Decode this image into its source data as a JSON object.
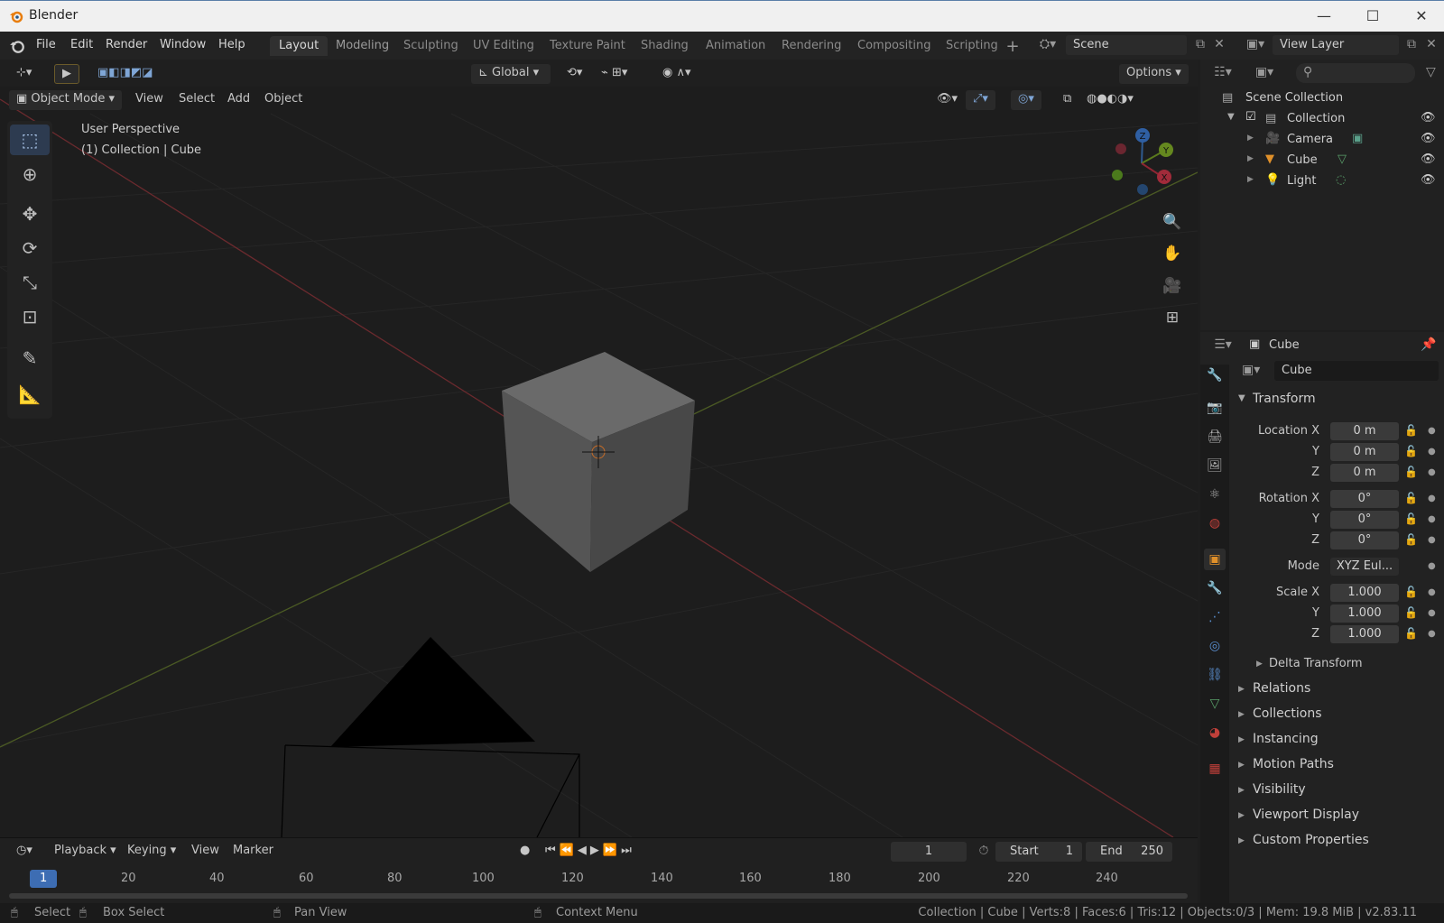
{
  "window": {
    "title": "Blender"
  },
  "menu": {
    "items": [
      "File",
      "Edit",
      "Render",
      "Window",
      "Help"
    ]
  },
  "workspaces": [
    {
      "label": "Layout",
      "active": true
    },
    {
      "label": "Modeling"
    },
    {
      "label": "Sculpting"
    },
    {
      "label": "UV Editing"
    },
    {
      "label": "Texture Paint"
    },
    {
      "label": "Shading"
    },
    {
      "label": "Animation"
    },
    {
      "label": "Rendering"
    },
    {
      "label": "Compositing"
    },
    {
      "label": "Scripting"
    }
  ],
  "scene": {
    "name": "Scene",
    "view_layer": "View Layer"
  },
  "viewport": {
    "transform_orientation": "Global",
    "options_label": "Options",
    "mode": "Object Mode",
    "header_menus": [
      "View",
      "Select",
      "Add",
      "Object"
    ],
    "perspective_text": "User Perspective",
    "context_text": "(1) Collection | Cube",
    "gizmo": {
      "x": "X",
      "y": "Y",
      "z": "Z"
    }
  },
  "outliner": {
    "root": "Scene Collection",
    "collection": "Collection",
    "objects": [
      "Camera",
      "Cube",
      "Light"
    ]
  },
  "properties": {
    "object_name_header": "Cube",
    "object_name_field": "Cube",
    "transform_title": "Transform",
    "location_label": "Location X",
    "rotation_label": "Rotation X",
    "mode_label": "Mode",
    "scale_label": "Scale X",
    "axis_y": "Y",
    "axis_z": "Z",
    "location": [
      "0 m",
      "0 m",
      "0 m"
    ],
    "rotation": [
      "0°",
      "0°",
      "0°"
    ],
    "rotation_mode": "XYZ Eul...",
    "scale": [
      "1.000",
      "1.000",
      "1.000"
    ],
    "delta_transform": "Delta Transform",
    "panels": [
      "Relations",
      "Collections",
      "Instancing",
      "Motion Paths",
      "Visibility",
      "Viewport Display",
      "Custom Properties"
    ]
  },
  "timeline": {
    "menus": [
      "Playback",
      "Keying",
      "View",
      "Marker"
    ],
    "current_frame": "1",
    "start_label": "Start",
    "start": "1",
    "end_label": "End",
    "end": "250",
    "ruler": [
      "1",
      "20",
      "40",
      "60",
      "80",
      "100",
      "120",
      "140",
      "160",
      "180",
      "200",
      "220",
      "240"
    ]
  },
  "statusbar": {
    "select": "Select",
    "box_select": "Box Select",
    "pan_view": "Pan View",
    "context_menu": "Context Menu",
    "stats": "Collection | Cube | Verts:8 | Faces:6 | Tris:12 | Objects:0/3 | Mem: 19.8 MiB | v2.83.11"
  }
}
